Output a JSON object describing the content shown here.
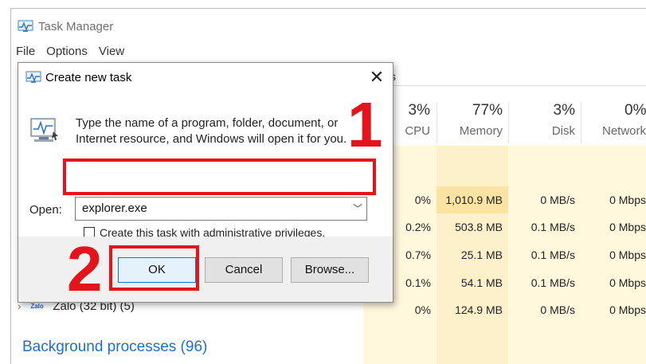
{
  "task_manager": {
    "title": "Task Manager",
    "menu": [
      "File",
      "Options",
      "View"
    ],
    "tab_fragment": "s",
    "columns": [
      {
        "pct": "3%",
        "label": "CPU"
      },
      {
        "pct": "77%",
        "label": "Memory"
      },
      {
        "pct": "3%",
        "label": "Disk"
      },
      {
        "pct": "0%",
        "label": "Network"
      }
    ],
    "rows": [
      {
        "cpu": "0%",
        "memory": "1,010.9 MB",
        "disk": "0 MB/s",
        "network": "0 Mbps"
      },
      {
        "cpu": "0.2%",
        "memory": "503.8 MB",
        "disk": "0.1 MB/s",
        "network": "0 Mbps"
      },
      {
        "cpu": "0.7%",
        "memory": "25.1 MB",
        "disk": "0.1 MB/s",
        "network": "0 Mbps"
      },
      {
        "cpu": "0.1%",
        "memory": "54.1 MB",
        "disk": "0.1 MB/s",
        "network": "0 Mbps"
      },
      {
        "cpu": "0%",
        "memory": "124.9 MB",
        "disk": "0 MB/s",
        "network": "0 Mbps"
      }
    ],
    "zalo_icon_text": "Zalo",
    "zalo_process": "Zalo (32 bit) (5)",
    "background_processes": "Background processes (96)"
  },
  "dialog": {
    "title": "Create new task",
    "close_glyph": "✕",
    "description": "Type the name of a program, folder, document, or Internet resource, and Windows will open it for you.",
    "open_label": "Open:",
    "open_value": "explorer.exe",
    "dropdown_glyph": "﹀",
    "admin_label": "Create this task with administrative privileges.",
    "buttons": {
      "ok": "OK",
      "cancel": "Cancel",
      "browse": "Browse..."
    }
  },
  "annotations": {
    "step1": "1",
    "step2": "2",
    "color": "#e3141c"
  },
  "colors": {
    "memory_highlight": "#fbe3a4",
    "memory_light": "#fdf1cc",
    "column_yellow": "#fff8dc",
    "link_blue": "#1e6fc9",
    "ok_focus": "#0078d7"
  }
}
